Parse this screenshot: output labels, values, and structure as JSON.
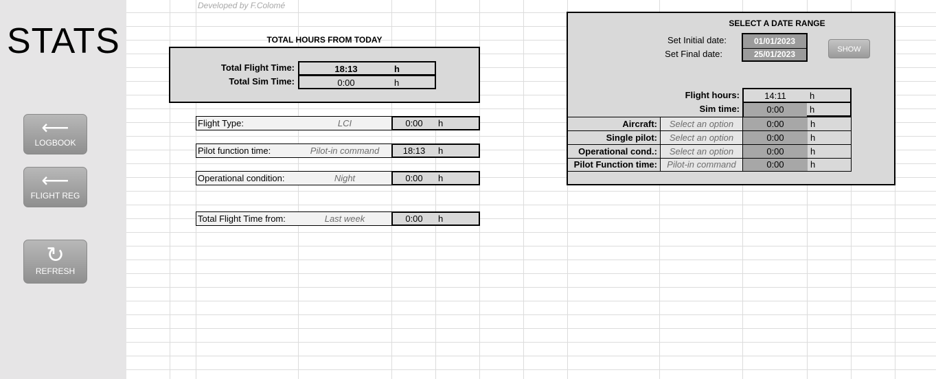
{
  "sidebar": {
    "title": "STATS",
    "buttons": [
      {
        "label": "LOGBOOK",
        "icon": "arrow-left-icon",
        "glyph": "⟵"
      },
      {
        "label": "FLIGHT REG",
        "icon": "arrow-left-icon",
        "glyph": "⟵"
      },
      {
        "label": "REFRESH",
        "icon": "refresh-icon",
        "glyph": "↻"
      }
    ]
  },
  "credit": "Developed by F.Colomé",
  "totals": {
    "heading": "TOTAL HOURS FROM TODAY",
    "flight_label": "Total Flight Time:",
    "flight_value": "18:13",
    "sim_label": "Total Sim Time:",
    "sim_value": "0:00",
    "unit": "h"
  },
  "filters": [
    {
      "label": "Flight Type:",
      "option": "LCI",
      "value": "0:00",
      "unit": "h"
    },
    {
      "label": "Pilot function time:",
      "option": "Pilot-in command",
      "value": "18:13",
      "unit": "h"
    },
    {
      "label": "Operational condition:",
      "option": "Night",
      "value": "0:00",
      "unit": "h"
    },
    {
      "label": "Total Flight Time from:",
      "option": "Last week",
      "value": "0:00",
      "unit": "h"
    }
  ],
  "range": {
    "heading": "SELECT A DATE RANGE",
    "initial_label": "Set Initial date:",
    "initial_value": "01/01/2023",
    "final_label": "Set Final date:",
    "final_value": "25/01/2023",
    "show_label": "SHOW",
    "flight_hours_label": "Flight hours:",
    "flight_hours_value": "14:11",
    "sim_label": "Sim time:",
    "sim_value": "0:00",
    "unit": "h",
    "rows": [
      {
        "label": "Aircraft:",
        "option": "Select an option",
        "value": "0:00"
      },
      {
        "label": "Single pilot:",
        "option": "Select an option",
        "value": "0:00"
      },
      {
        "label": "Operational cond.:",
        "option": "Select an option",
        "value": "0:00"
      },
      {
        "label": "Pilot Function time:",
        "option": "Pilot-in command",
        "value": "0:00"
      }
    ]
  }
}
